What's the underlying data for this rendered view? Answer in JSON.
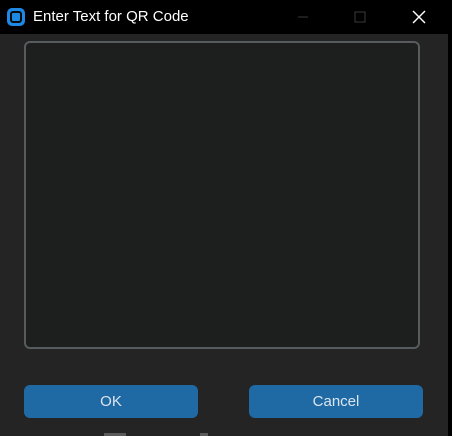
{
  "window": {
    "title": "Enter Text for QR Code",
    "app_icon": "app-logo-icon",
    "controls": {
      "minimize_icon": "minimize-icon",
      "maximize_icon": "maximize-icon",
      "close_icon": "close-icon"
    }
  },
  "text_input": {
    "value": "",
    "placeholder": ""
  },
  "buttons": {
    "ok_label": "OK",
    "cancel_label": "Cancel"
  },
  "colors": {
    "window_background": "#242424",
    "titlebar_background": "#000000",
    "accent": "#1f6aa5",
    "textbox_background": "#1d1e1e",
    "textbox_border": "#565b5e",
    "button_text": "#dce4ee"
  }
}
